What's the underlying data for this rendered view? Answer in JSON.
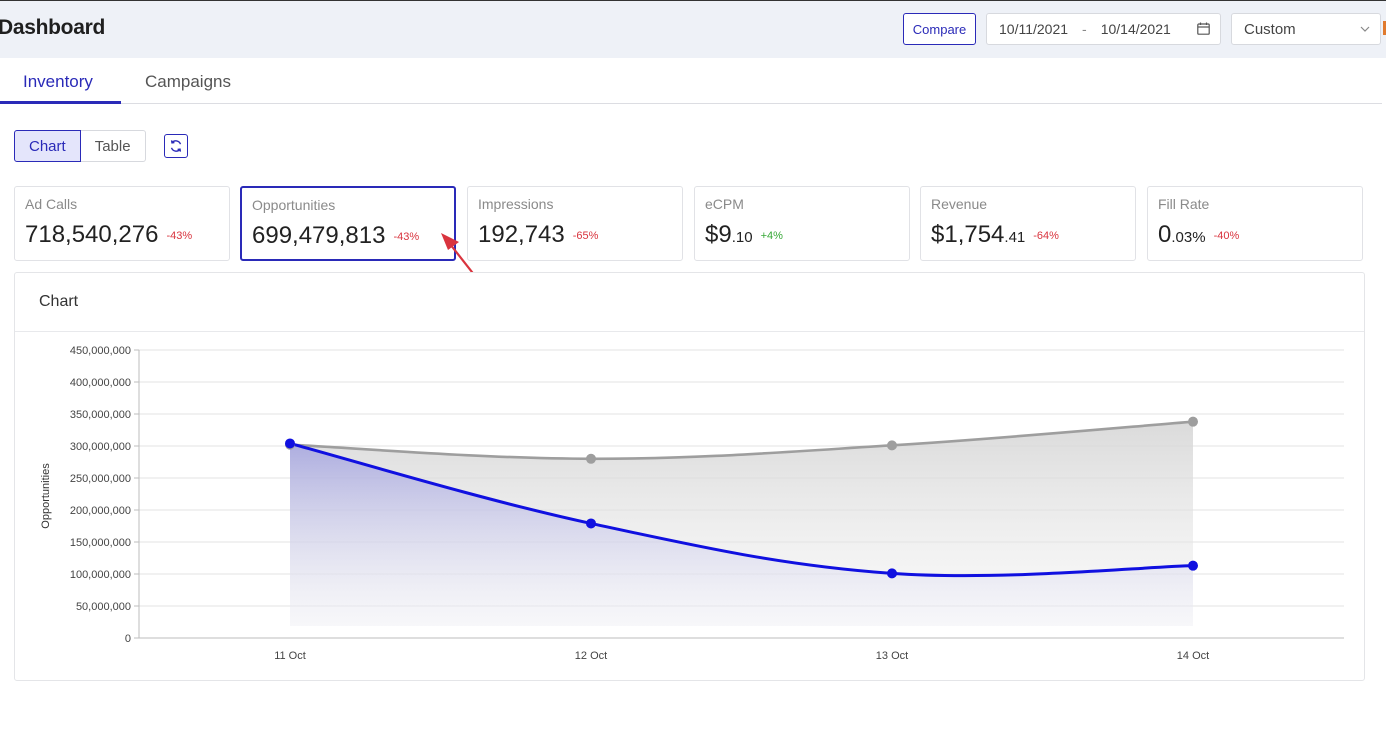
{
  "header": {
    "title": "Dashboard",
    "compare_label": "Compare",
    "date_start": "10/11/2021",
    "date_separator": "-",
    "date_end": "10/14/2021",
    "range_select": "Custom"
  },
  "tabs": [
    {
      "label": "Inventory",
      "active": true
    },
    {
      "label": "Campaigns",
      "active": false
    }
  ],
  "view_toggle": {
    "chart_label": "Chart",
    "table_label": "Table",
    "active": "Chart"
  },
  "metrics": [
    {
      "label": "Ad Calls",
      "value": "718,540,276",
      "value_small": "",
      "change": "-43%",
      "direction": "down"
    },
    {
      "label": "Opportunities",
      "value": "699,479,813",
      "value_small": "",
      "change": "-43%",
      "direction": "down",
      "selected": true
    },
    {
      "label": "Impressions",
      "value": "192,743",
      "value_small": "",
      "change": "-65%",
      "direction": "down"
    },
    {
      "label": "eCPM",
      "value": "$9",
      "value_small": ".10",
      "change": "+4%",
      "direction": "up"
    },
    {
      "label": "Revenue",
      "value": "$1,754",
      "value_small": ".41",
      "change": "-64%",
      "direction": "down"
    },
    {
      "label": "Fill Rate",
      "value": "0",
      "value_small": ".03%",
      "change": "-40%",
      "direction": "down"
    }
  ],
  "chart_panel": {
    "title": "Chart"
  },
  "colors": {
    "accent": "#2a2ab8",
    "negative": "#d9343e",
    "positive": "#36a836",
    "primary_series": "#1010e0",
    "compare_series": "#9e9e9e"
  },
  "chart_data": {
    "type": "area",
    "categories": [
      "11 Oct",
      "12 Oct",
      "13 Oct",
      "14 Oct"
    ],
    "ylabel": "Opportunities",
    "ylim": [
      0,
      450000000
    ],
    "yticks": [
      0,
      50000000,
      100000000,
      150000000,
      200000000,
      250000000,
      300000000,
      350000000,
      400000000,
      450000000
    ],
    "ytick_labels": [
      "0",
      "50,000,000",
      "100,000,000",
      "150,000,000",
      "200,000,000",
      "250,000,000",
      "300,000,000",
      "350,000,000",
      "400,000,000",
      "450,000,000"
    ],
    "grid": true,
    "series": [
      {
        "values": [
          302000000,
          280000000,
          301000000,
          338000000
        ],
        "color": "#9e9e9e"
      },
      {
        "values": [
          304000000,
          179000000,
          101000000,
          113000000
        ],
        "color": "#1010e0"
      }
    ]
  }
}
